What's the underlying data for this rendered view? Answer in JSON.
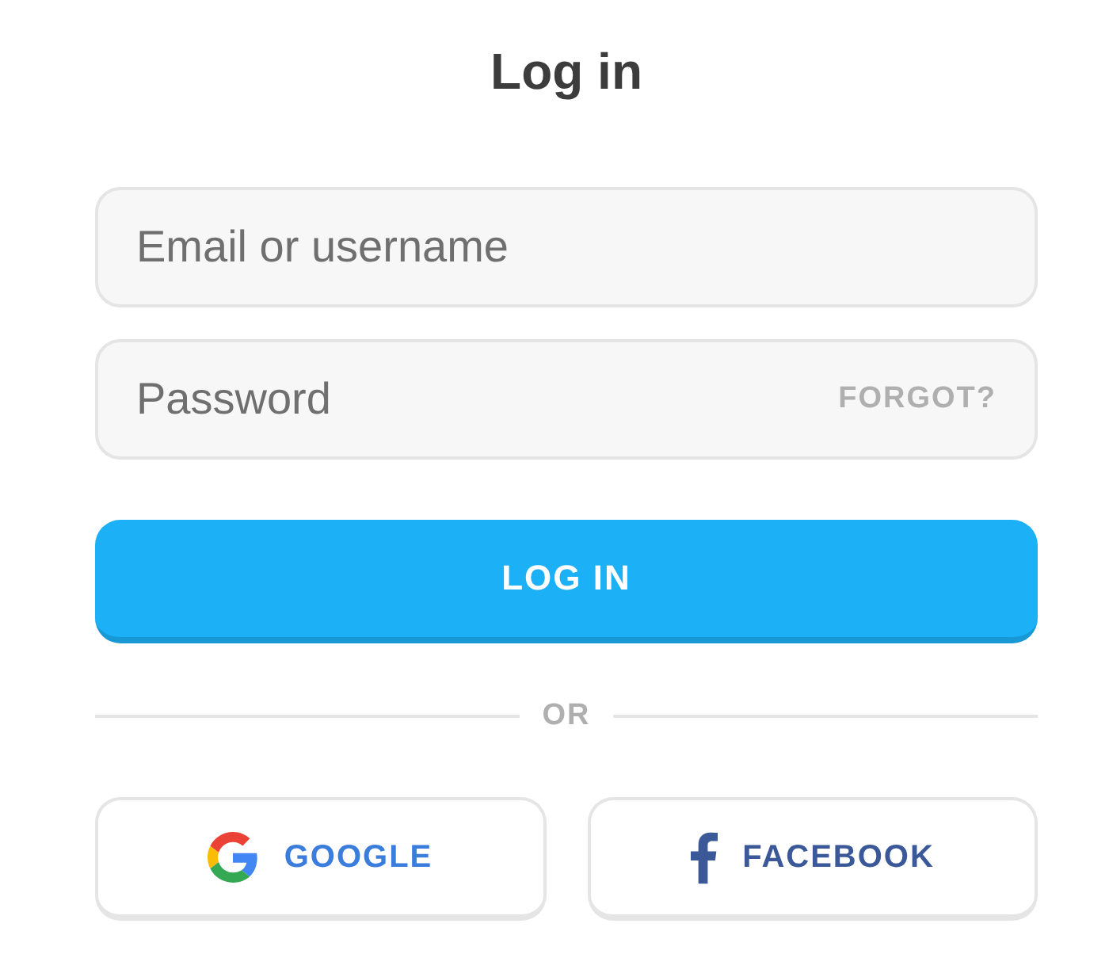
{
  "title": "Log in",
  "fields": [
    {
      "placeholder": "Email or username"
    },
    {
      "placeholder": "Password",
      "action": "FORGOT?"
    }
  ],
  "login_button": "LOG IN",
  "divider": "OR",
  "social_buttons": [
    {
      "kind": "google",
      "label": "GOOGLE"
    },
    {
      "kind": "facebook",
      "label": "FACEBOOK"
    }
  ]
}
